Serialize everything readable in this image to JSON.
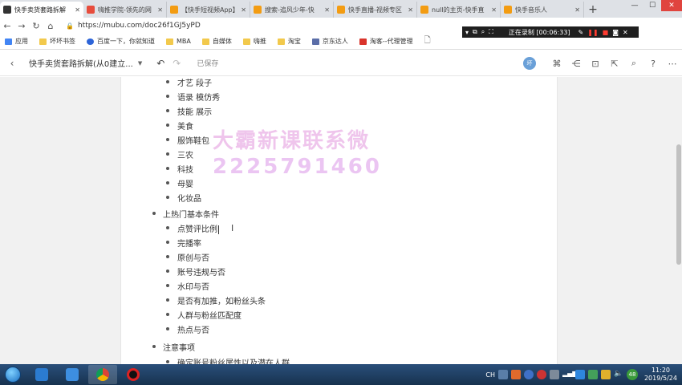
{
  "browser": {
    "tabs": [
      {
        "label": "快手卖货套路拆解",
        "active": true,
        "color": "#333333"
      },
      {
        "label": "嗨推学院-领先的网",
        "active": false,
        "color": "#e74c3c"
      },
      {
        "label": "【快手短视频App】",
        "active": false,
        "color": "#f39c12"
      },
      {
        "label": "搜索-追风少年-快",
        "active": false,
        "color": "#f39c12"
      },
      {
        "label": "快手直播-视频专区",
        "active": false,
        "color": "#f39c12"
      },
      {
        "label": "null的主页-快手直",
        "active": false,
        "color": "#f39c12"
      },
      {
        "label": "快手音乐人",
        "active": false,
        "color": "#f39c12"
      }
    ],
    "url": "https://mubu.com/doc26f1GJ5yPD",
    "recording": {
      "text": "正在录制 [00:06:33]"
    },
    "bookmarks": [
      {
        "label": "应用",
        "icon": "apps-icon"
      },
      {
        "label": "坏坏书签",
        "icon": "folder-icon"
      },
      {
        "label": "百度一下，你就知道",
        "icon": "baidu-icon"
      },
      {
        "label": "MBA",
        "icon": "folder-icon"
      },
      {
        "label": "自媒体",
        "icon": "folder-icon"
      },
      {
        "label": "嗨推",
        "icon": "folder-icon"
      },
      {
        "label": "淘宝",
        "icon": "folder-icon"
      },
      {
        "label": "京东达人",
        "icon": "jd-icon"
      },
      {
        "label": "淘客--代理管理",
        "icon": "taoke-icon"
      }
    ]
  },
  "app": {
    "doc_title": "快手卖货套路拆解(从0建立...",
    "saved_status": "已保存",
    "avatar_text": "坏"
  },
  "document": {
    "children_top": [
      "才艺 段子",
      "语录 模仿秀",
      "技能 展示",
      "美食",
      "服饰鞋包",
      "三农",
      "科技",
      "母婴",
      "化妆品"
    ],
    "section2": {
      "title": "上热门基本条件",
      "children": [
        "点赞评比例",
        "完播率",
        "原创与否",
        "账号违规与否",
        "水印与否",
        "是否有加推，如粉丝头条",
        "人群与粉丝匹配度",
        "热点与否"
      ]
    },
    "section3": {
      "title": "注意事项",
      "children": [
        "确定账号粉丝属性以及潜在人群"
      ]
    }
  },
  "watermark": {
    "line1": "大霸新课联系微",
    "line2": "2225791460"
  },
  "taskbar": {
    "clock_time": "11:20",
    "clock_date": "2019/5/24",
    "tray_badge": "48",
    "ime": "CH"
  }
}
